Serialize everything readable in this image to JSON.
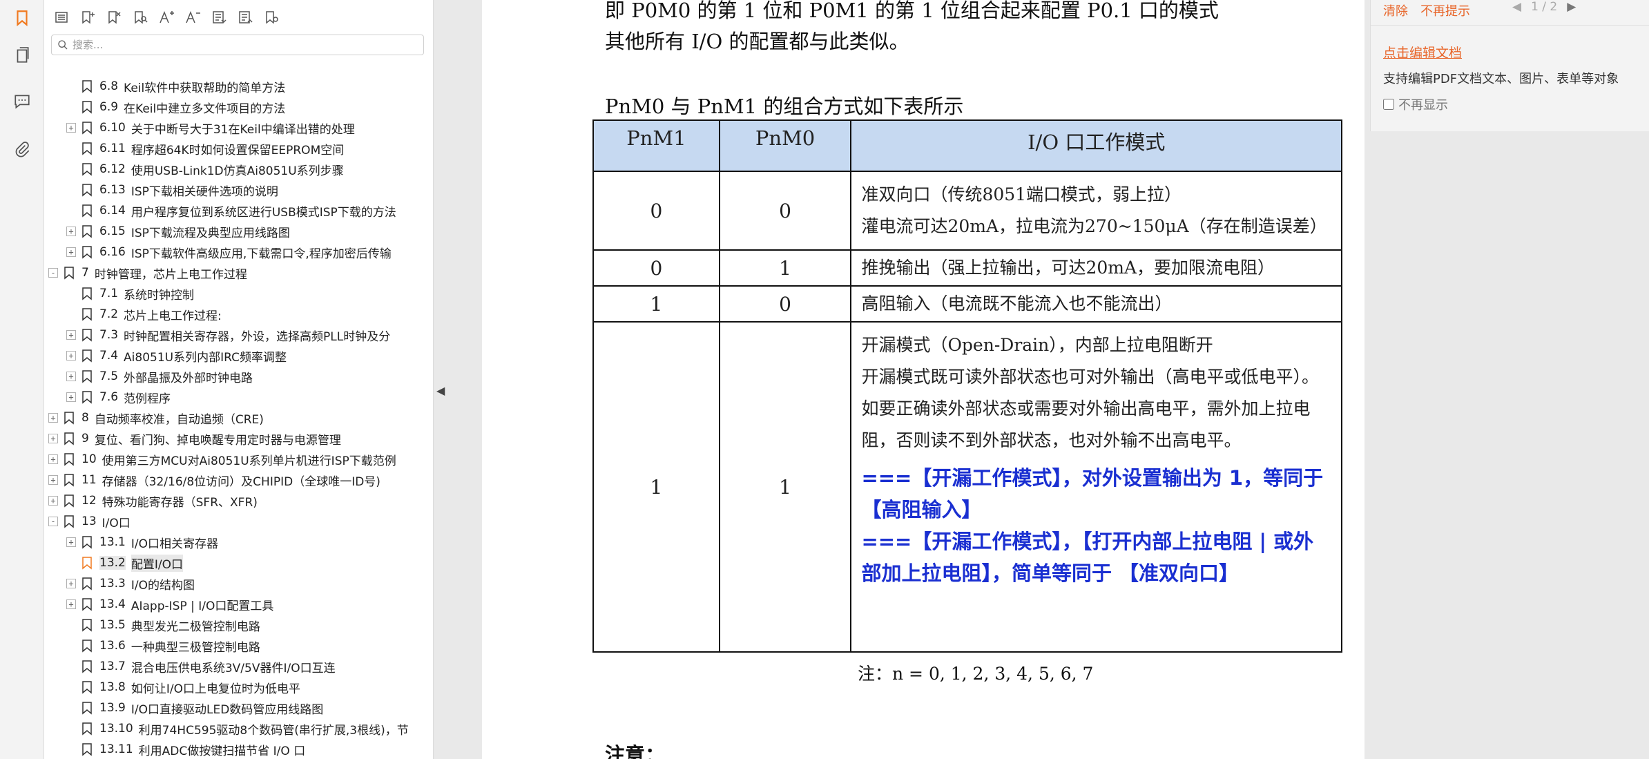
{
  "rail": {
    "icons": [
      "bookmark-icon",
      "pages-icon",
      "comment-icon",
      "attachment-icon"
    ]
  },
  "panel": {
    "toolbar": [
      "list-icon",
      "add-bookmark-icon",
      "delete-bookmark-icon",
      "find-bookmark-icon",
      "increase-font-icon",
      "decrease-font-icon",
      "expand-all-icon",
      "collapse-all-icon",
      "bookmark-settings-icon"
    ],
    "search_placeholder": "搜索..."
  },
  "bookmarks": [
    {
      "level": 2,
      "exp": "",
      "num": "6.8",
      "label": "Keil软件中获取帮助的简单方法"
    },
    {
      "level": 2,
      "exp": "",
      "num": "6.9",
      "label": "在Keil中建立多文件项目的方法"
    },
    {
      "level": 2,
      "exp": "+",
      "num": "6.10",
      "label": "关于中断号大于31在Keil中编译出错的处理"
    },
    {
      "level": 2,
      "exp": "",
      "num": "6.11",
      "label": "程序超64K时如何设置保留EEPROM空间"
    },
    {
      "level": 2,
      "exp": "",
      "num": "6.12",
      "label": "使用USB-Link1D仿真Ai8051U系列步骤"
    },
    {
      "level": 2,
      "exp": "",
      "num": "6.13",
      "label": "ISP下载相关硬件选项的说明"
    },
    {
      "level": 2,
      "exp": "",
      "num": "6.14",
      "label": "用户程序复位到系统区进行USB模式ISP下载的方法"
    },
    {
      "level": 2,
      "exp": "+",
      "num": "6.15",
      "label": "ISP下载流程及典型应用线路图"
    },
    {
      "level": 2,
      "exp": "+",
      "num": "6.16",
      "label": "ISP下载软件高级应用,下载需口令,程序加密后传输"
    },
    {
      "level": 1,
      "exp": "-",
      "num": "7",
      "label": "时钟管理，芯片上电工作过程"
    },
    {
      "level": 2,
      "exp": "",
      "num": "7.1",
      "label": "系统时钟控制"
    },
    {
      "level": 2,
      "exp": "",
      "num": "7.2",
      "label": "芯片上电工作过程:"
    },
    {
      "level": 2,
      "exp": "+",
      "num": "7.3",
      "label": "时钟配置相关寄存器，外设，选择高频PLL时钟及分"
    },
    {
      "level": 2,
      "exp": "+",
      "num": "7.4",
      "label": "Ai8051U系列内部IRC频率调整"
    },
    {
      "level": 2,
      "exp": "+",
      "num": "7.5",
      "label": "外部晶振及外部时钟电路"
    },
    {
      "level": 2,
      "exp": "+",
      "num": "7.6",
      "label": "范例程序"
    },
    {
      "level": 1,
      "exp": "+",
      "num": "8",
      "label": "自动频率校准，自动追频（CRE)"
    },
    {
      "level": 1,
      "exp": "+",
      "num": "9",
      "label": "复位、看门狗、掉电唤醒专用定时器与电源管理"
    },
    {
      "level": 1,
      "exp": "+",
      "num": "10",
      "label": "使用第三方MCU对Ai8051U系列单片机进行ISP下载范例"
    },
    {
      "level": 1,
      "exp": "+",
      "num": "11",
      "label": "存储器（32/16/8位访问）及CHIPID（全球唯一ID号)"
    },
    {
      "level": 1,
      "exp": "+",
      "num": "12",
      "label": "特殊功能寄存器（SFR、XFR)"
    },
    {
      "level": 1,
      "exp": "-",
      "num": "13",
      "label": "I/O口"
    },
    {
      "level": 2,
      "exp": "+",
      "num": "13.1",
      "label": "I/O口相关寄存器"
    },
    {
      "level": 2,
      "exp": "",
      "num": "13.2",
      "label": "配置I/O口",
      "selected": true
    },
    {
      "level": 2,
      "exp": "+",
      "num": "13.3",
      "label": "I/O的结构图"
    },
    {
      "level": 2,
      "exp": "+",
      "num": "13.4",
      "label": "AIapp-ISP | I/O口配置工具"
    },
    {
      "level": 2,
      "exp": "",
      "num": "13.5",
      "label": "典型发光二极管控制电路"
    },
    {
      "level": 2,
      "exp": "",
      "num": "13.6",
      "label": "一种典型三极管控制电路"
    },
    {
      "level": 2,
      "exp": "",
      "num": "13.7",
      "label": "混合电压供电系统3V/5V器件I/O口互连"
    },
    {
      "level": 2,
      "exp": "",
      "num": "13.8",
      "label": "如何让I/O口上电复位时为低电平"
    },
    {
      "level": 2,
      "exp": "",
      "num": "13.9",
      "label": "I/O口直接驱动LED数码管应用线路图"
    },
    {
      "level": 2,
      "exp": "",
      "num": "13.10",
      "label": "利用74HC595驱动8个数码管(串行扩展,3根线)，节"
    },
    {
      "level": 2,
      "exp": "",
      "num": "13.11",
      "label": "利用ADC做按键扫描节省 I/O 口"
    }
  ],
  "document": {
    "line1": "即 P0M0 的第 1 位和 P0M1 的第 1 位组合起来配置 P0.1 口的模式",
    "line2": "其他所有 I/O 的配置都与此类似。",
    "table_caption": "PnM0 与 PnM1 的组合方式如下表所示",
    "headers": [
      "PnM1",
      "PnM0",
      "I/O 口工作模式"
    ],
    "rows": [
      {
        "m1": "0",
        "m0": "0",
        "mode": [
          "准双向口（传统8051端口模式，弱上拉）",
          "灌电流可达20mA，拉电流为270~150μA（存在制造误差）"
        ]
      },
      {
        "m1": "0",
        "m0": "1",
        "mode": [
          "推挽输出（强上拉输出，可达20mA，要加限流电阻）"
        ]
      },
      {
        "m1": "1",
        "m0": "0",
        "mode": [
          "高阻输入（电流既不能流入也不能流出）"
        ]
      },
      {
        "m1": "1",
        "m0": "1",
        "mode": [
          "开漏模式（Open-Drain），内部上拉电阻断开",
          "开漏模式既可读外部状态也可对外输出（高电平或低电平）。如要正确读外部状态或需要对外输出高电平，需外加上拉电阻，否则读不到外部状态，也对外输不出高电平。"
        ],
        "blue": [
          "===【开漏工作模式】，对外设置输出为 1，等同于 【高阻输入】",
          "===【开漏工作模式】，【打开内部上拉电阻 | 或外部加上拉电阻】，简单等同于 【准双向口】"
        ]
      }
    ],
    "note": "注：n = 0, 1, 2, 3, 4, 5, 6, 7",
    "attention": "注意："
  },
  "tip": {
    "clear": "清除",
    "dont_remind": "不再提示",
    "page": "1 / 2",
    "edit_link": "点击编辑文档",
    "desc": "支持编辑PDF文档文本、图片、表单等对象",
    "dont_show": "不再显示"
  }
}
